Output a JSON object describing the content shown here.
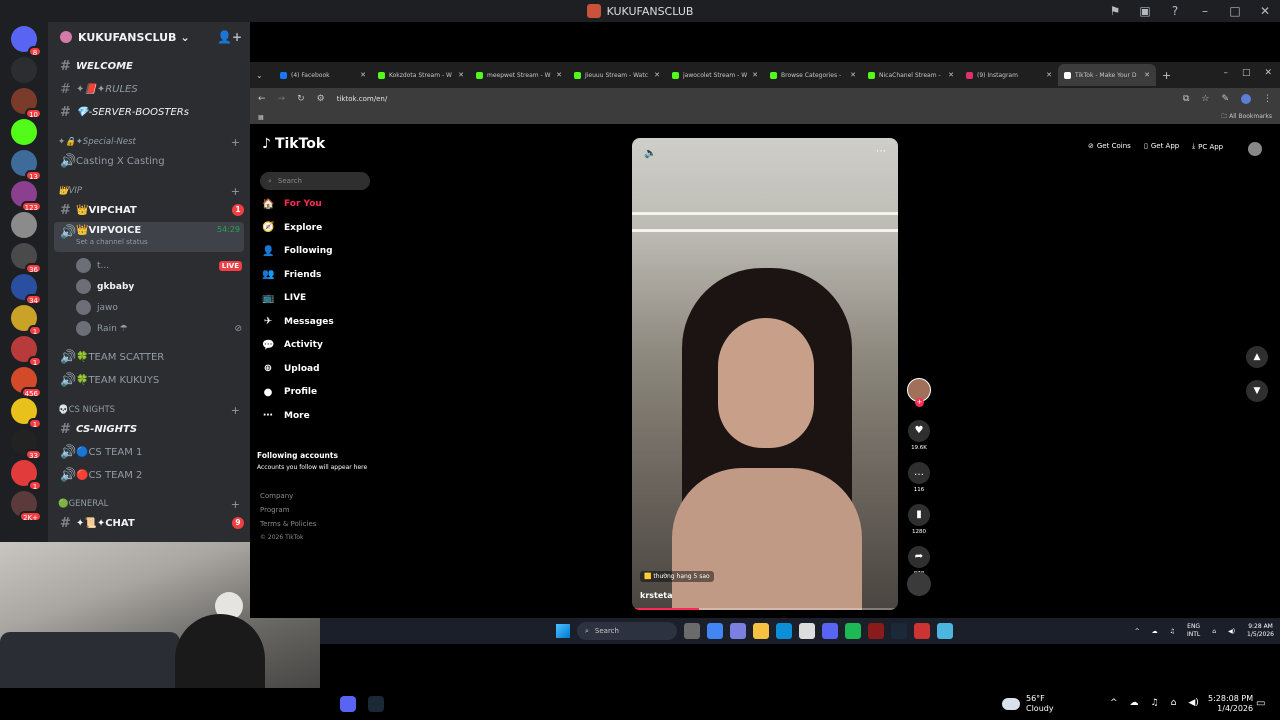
{
  "window": {
    "title": "KUKUFANSCLUB"
  },
  "guilds": [
    {
      "badge": "8",
      "color": "#5865f2"
    },
    {
      "badge": "",
      "color": "#2b2d31"
    },
    {
      "badge": "10",
      "color": "#7b3b2b"
    },
    {
      "badge": "",
      "color": "#53fc18"
    },
    {
      "badge": "13",
      "color": "#3f6b9a"
    },
    {
      "badge": "123",
      "color": "#8a3f8f"
    },
    {
      "badge": "",
      "color": "#8b8b8b"
    },
    {
      "badge": "36",
      "color": "#4a4a4a"
    },
    {
      "badge": "34",
      "color": "#2a4fa0"
    },
    {
      "badge": "1",
      "color": "#c9a227"
    },
    {
      "badge": "1",
      "color": "#b83b3b"
    },
    {
      "badge": "456",
      "color": "#d24a2a"
    },
    {
      "badge": "1",
      "color": "#e8c21b"
    },
    {
      "badge": "33",
      "color": "#222"
    },
    {
      "badge": "1",
      "color": "#e23b3b"
    },
    {
      "badge": "2K+",
      "color": "#5a3a3a"
    }
  ],
  "server": {
    "name": "KUKUFANSCLUB"
  },
  "channels": {
    "welcome": "WELCOME",
    "rules": "✦📕✦RULES",
    "boosters": "💎-SERVER-BOOSTERs",
    "cat_special": "✦🔒✦Special-Nest",
    "casting": "Casting X Casting",
    "cat_vip": "👑VIP",
    "vipchat": "👑VIPCHAT",
    "vipchat_badge": "1",
    "vipvoice": "👑VIPVOICE",
    "vipvoice_time": "54:29",
    "vipvoice_status": "Set a channel status",
    "voice_users": [
      {
        "name": "t...",
        "live": "LIVE"
      },
      {
        "name": "gkbaby",
        "live": ""
      },
      {
        "name": "jawo",
        "live": ""
      },
      {
        "name": "Rain ☂",
        "live": ""
      }
    ],
    "team_scatter": "🍀TEAM SCATTER",
    "team_kukuys": "🍀TEAM KUKUYS",
    "cat_cs": "💀CS NIGHTS",
    "cs_nights": "CS-NIGHTS",
    "cs_team1": "🔵CS TEAM 1",
    "cs_team2": "🔴CS TEAM 2",
    "cat_general": "🟢GENERAL",
    "chat": "✦📜✦CHAT",
    "chat_badge": "9"
  },
  "browser": {
    "tabs": [
      {
        "label": "(4) Facebook",
        "color": "#1877f2"
      },
      {
        "label": "Kokzdota Stream - W",
        "color": "#53fc18"
      },
      {
        "label": "meepwet Stream - W",
        "color": "#53fc18"
      },
      {
        "label": "Jieuuu Stream - Watc",
        "color": "#53fc18"
      },
      {
        "label": "jawocolet Stream - W",
        "color": "#53fc18"
      },
      {
        "label": "Browse Categories -",
        "color": "#53fc18"
      },
      {
        "label": "NicaChanel Stream -",
        "color": "#53fc18"
      },
      {
        "label": "(9) Instagram",
        "color": "#e1306c"
      },
      {
        "label": "TikTok - Make Your D",
        "color": "#ffffff"
      }
    ],
    "url": "tiktok.com/en/",
    "bookmarks_label": "All Bookmarks"
  },
  "tiktok": {
    "brand": "TikTok",
    "search_placeholder": "Search",
    "nav": [
      {
        "label": "For You",
        "icon": "🏠"
      },
      {
        "label": "Explore",
        "icon": "🧭"
      },
      {
        "label": "Following",
        "icon": "👤"
      },
      {
        "label": "Friends",
        "icon": "👥"
      },
      {
        "label": "LIVE",
        "icon": "📺"
      },
      {
        "label": "Messages",
        "icon": "✈"
      },
      {
        "label": "Activity",
        "icon": "💬"
      },
      {
        "label": "Upload",
        "icon": "⊕"
      },
      {
        "label": "Profile",
        "icon": "●"
      },
      {
        "label": "More",
        "icon": "⋯"
      }
    ],
    "following_title": "Following accounts",
    "following_sub": "Accounts you follow will appear here",
    "footer": [
      "Company",
      "Program",
      "Terms & Policies",
      "© 2026 TikTok"
    ],
    "top": {
      "coins": "Get Coins",
      "app": "Get App",
      "pc": "PC App"
    },
    "video": {
      "username": "krsteta",
      "tag": "🟨 thường hạng 5 sao",
      "progress": 0.25,
      "likes": "19.6K",
      "comments": "116",
      "saves": "1280",
      "shares": "878"
    }
  },
  "inner_taskbar": {
    "search": "Search",
    "lang1": "ENG",
    "lang2": "INTL",
    "time": "9:28 AM",
    "date": "1/5/2026"
  },
  "outer_taskbar": {
    "temp": "56°F",
    "weather": "Cloudy",
    "time": "5:28:08 PM",
    "date": "1/4/2026"
  }
}
